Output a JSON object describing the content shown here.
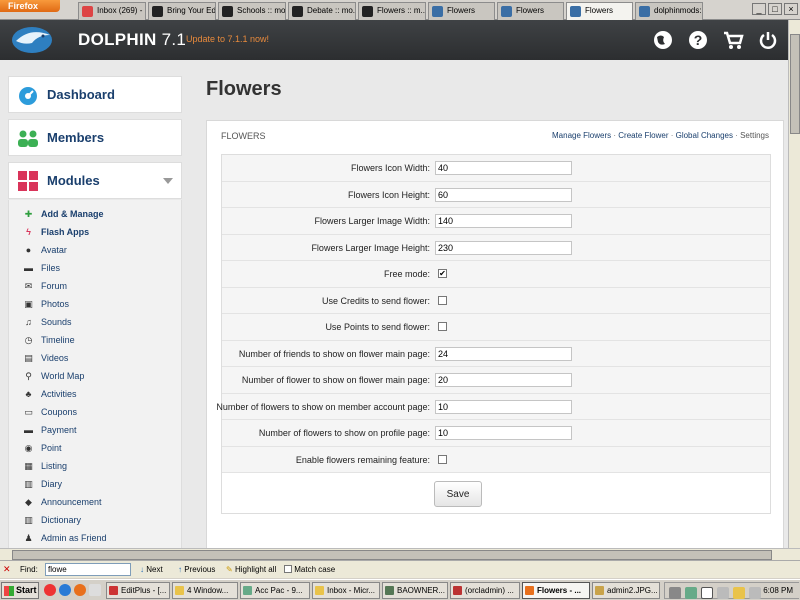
{
  "browser": {
    "app_button": "Firefox",
    "tabs": [
      {
        "label": "Inbox (269) - ...",
        "fav": "#d44"
      },
      {
        "label": "Bring Your Ed...",
        "fav": "#222"
      },
      {
        "label": "Schools :: mo...",
        "fav": "#222"
      },
      {
        "label": "Debate :: mo...",
        "fav": "#222"
      },
      {
        "label": "Flowers :: m...",
        "fav": "#222"
      },
      {
        "label": "Flowers",
        "fav": "#3a6ea5"
      },
      {
        "label": "Flowers",
        "fav": "#3a6ea5"
      },
      {
        "label": "Flowers",
        "fav": "#3a6ea5",
        "active": true
      },
      {
        "label": "dolphinmods:...",
        "fav": "#3a6ea5"
      }
    ]
  },
  "header": {
    "title": "DOLPHIN",
    "version": "7.1",
    "update_link": "Update to 7.1.1 now!",
    "icons": [
      "globe-icon",
      "help-icon",
      "cart-icon",
      "power-icon"
    ]
  },
  "menu": {
    "dashboard": "Dashboard",
    "members": "Members",
    "modules": "Modules",
    "items": [
      {
        "label": "Add & Manage",
        "icon": "plus-icon",
        "bold": true
      },
      {
        "label": "Flash Apps",
        "icon": "flash-icon",
        "bold": true
      },
      {
        "label": "Avatar",
        "icon": "avatar-icon"
      },
      {
        "label": "Files",
        "icon": "files-icon"
      },
      {
        "label": "Forum",
        "icon": "forum-icon"
      },
      {
        "label": "Photos",
        "icon": "photos-icon"
      },
      {
        "label": "Sounds",
        "icon": "sounds-icon"
      },
      {
        "label": "Timeline",
        "icon": "timeline-icon"
      },
      {
        "label": "Videos",
        "icon": "videos-icon"
      },
      {
        "label": "World Map",
        "icon": "map-pin-icon"
      },
      {
        "label": "Activities",
        "icon": "activities-icon"
      },
      {
        "label": "Coupons",
        "icon": "coupons-icon"
      },
      {
        "label": "Payment",
        "icon": "payment-icon"
      },
      {
        "label": "Point",
        "icon": "point-icon"
      },
      {
        "label": "Listing",
        "icon": "listing-icon"
      },
      {
        "label": "Diary",
        "icon": "diary-icon"
      },
      {
        "label": "Announcement",
        "icon": "announcement-icon"
      },
      {
        "label": "Dictionary",
        "icon": "dictionary-icon"
      },
      {
        "label": "Admin as Friend",
        "icon": "admin-friend-icon"
      }
    ]
  },
  "page": {
    "title": "Flowers",
    "panel_title": "FLOWERS",
    "links": {
      "manage": "Manage Flowers",
      "create": "Create Flower",
      "global": "Global Changes",
      "settings": "Settings"
    },
    "fields": [
      {
        "label": "Flowers Icon Width:",
        "type": "text",
        "value": "40"
      },
      {
        "label": "Flowers Icon Height:",
        "type": "text",
        "value": "60"
      },
      {
        "label": "Flowers Larger Image Width:",
        "type": "text",
        "value": "140"
      },
      {
        "label": "Flowers Larger Image Height:",
        "type": "text",
        "value": "230"
      },
      {
        "label": "Free mode:",
        "type": "checkbox",
        "checked": true
      },
      {
        "label": "Use Credits to send flower:",
        "type": "checkbox",
        "checked": false
      },
      {
        "label": "Use Points to send flower:",
        "type": "checkbox",
        "checked": false
      },
      {
        "label": "Number of friends to show on flower main page:",
        "type": "text",
        "value": "24"
      },
      {
        "label": "Number of flower to show on flower main page:",
        "type": "text",
        "value": "20"
      },
      {
        "label": "Number of flowers to show on member account page:",
        "type": "text",
        "value": "10"
      },
      {
        "label": "Number of flowers to show on profile page:",
        "type": "text",
        "value": "10"
      },
      {
        "label": "Enable flowers remaining feature:",
        "type": "checkbox",
        "checked": false
      }
    ],
    "save_label": "Save"
  },
  "findbar": {
    "label": "Find:",
    "value": "flowe",
    "next": "Next",
    "previous": "Previous",
    "highlight": "Highlight all",
    "match_case": "Match case"
  },
  "taskbar": {
    "start": "Start",
    "items": [
      {
        "label": "EditPlus - [...",
        "color": "#c33"
      },
      {
        "label": "4 Window...",
        "color": "#e9c34a"
      },
      {
        "label": "Acc Pac - 9...",
        "color": "#6a8"
      },
      {
        "label": "Inbox - Micr...",
        "color": "#e9c34a"
      },
      {
        "label": "BAOWNER...",
        "color": "#575"
      },
      {
        "label": "(orcladmin) ...",
        "color": "#b33"
      },
      {
        "label": "Flowers - ...",
        "color": "#e8701c",
        "active": true
      },
      {
        "label": "admin2.JPG...",
        "color": "#c9a34a"
      }
    ],
    "clock": "6:08 PM"
  }
}
